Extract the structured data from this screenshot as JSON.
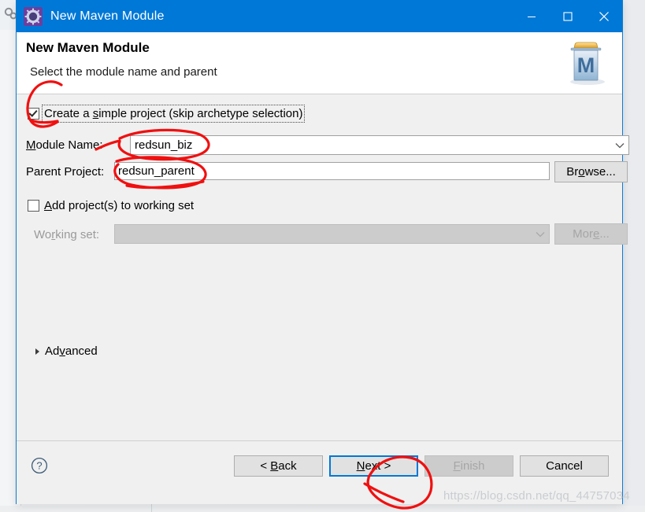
{
  "window": {
    "title": "New Maven Module",
    "icon": "maven-gear-icon",
    "accent_color": "#0078d7",
    "controls": {
      "minimize": "minimize-icon",
      "maximize": "maximize-icon",
      "close": "close-icon"
    }
  },
  "header": {
    "title": "New Maven Module",
    "subtitle": "Select the module name and parent",
    "banner_icon": "maven-folder-m-icon"
  },
  "form": {
    "simple_project": {
      "label": "Create a simple project (skip archetype selection)",
      "checked": true
    },
    "module_name": {
      "label": "Module Name:",
      "value": "redsun_biz",
      "placeholder": ""
    },
    "parent_project": {
      "label": "Parent Project:",
      "value": "redsun_parent",
      "placeholder": "",
      "browse_label": "Browse..."
    },
    "working_set_checkbox": {
      "label": "Add project(s) to working set",
      "checked": false
    },
    "working_set": {
      "label": "Working set:",
      "value": "",
      "enabled": false,
      "more_label": "More..."
    },
    "advanced": {
      "label": "Advanced",
      "expanded": false
    }
  },
  "footer": {
    "help_icon": "help-question-icon",
    "buttons": {
      "back": "< Back",
      "next": "Next >",
      "finish": "Finish",
      "cancel": "Cancel"
    },
    "default_button": "Next >",
    "disabled_buttons": [
      "Finish"
    ]
  },
  "watermark": {
    "text": "https://blog.csdn.net/qq_44757034",
    "color": "#c9cdd1"
  },
  "annotations": {
    "color": "#f01010",
    "marks": [
      "ellipse-around-simple-project-checkbox",
      "ellipse-around-module-name-value",
      "ellipse-around-parent-project-value",
      "ellipse-around-next-button"
    ]
  }
}
